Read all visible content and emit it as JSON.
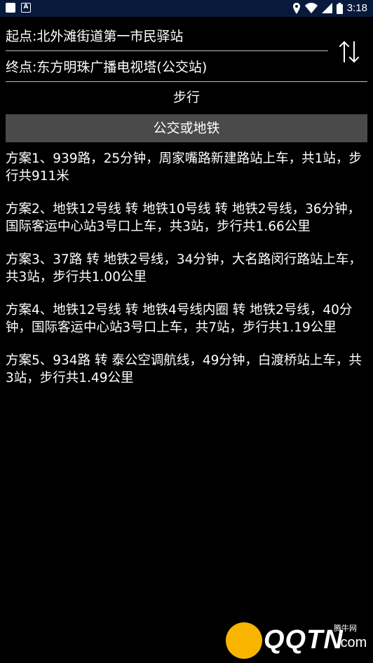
{
  "status_bar": {
    "time": "3:18",
    "icons": [
      "notification-square-icon",
      "a-badge-icon",
      "location-icon",
      "wifi-icon",
      "signal-icon",
      "battery-icon"
    ]
  },
  "route": {
    "start": "起点:北外滩街道第一市民驿站",
    "end": "终点:东方明珠广播电视塔(公交站)",
    "swap_icon": "swap-vertical-icon"
  },
  "modes": {
    "walk": "步行",
    "transit": "公交或地铁"
  },
  "plans": [
    "方案1、939路，25分钟，周家嘴路新建路站上车，共1站，步行共911米",
    "方案2、地铁12号线 转 地铁10号线 转 地铁2号线，36分钟，国际客运中心站3号口上车，共3站，步行共1.66公里",
    "方案3、37路 转 地铁2号线，34分钟，大名路闵行路站上车，共3站，步行共1.00公里",
    "方案4、地铁12号线 转 地铁4号线内圈 转 地铁2号线，40分钟，国际客运中心站3号口上车，共7站，步行共1.19公里",
    "方案5、934路 转 泰公空调航线，49分钟，白渡桥站上车，共3站，步行共1.49公里"
  ],
  "watermark": {
    "brand": "QQTN",
    "suffix": ".com",
    "cn": "腾牛网"
  },
  "colors": {
    "background": "#000000",
    "status_bar": "#081a3c",
    "selected_mode": "#4a4a4a",
    "divider": "#bdbdbd"
  }
}
